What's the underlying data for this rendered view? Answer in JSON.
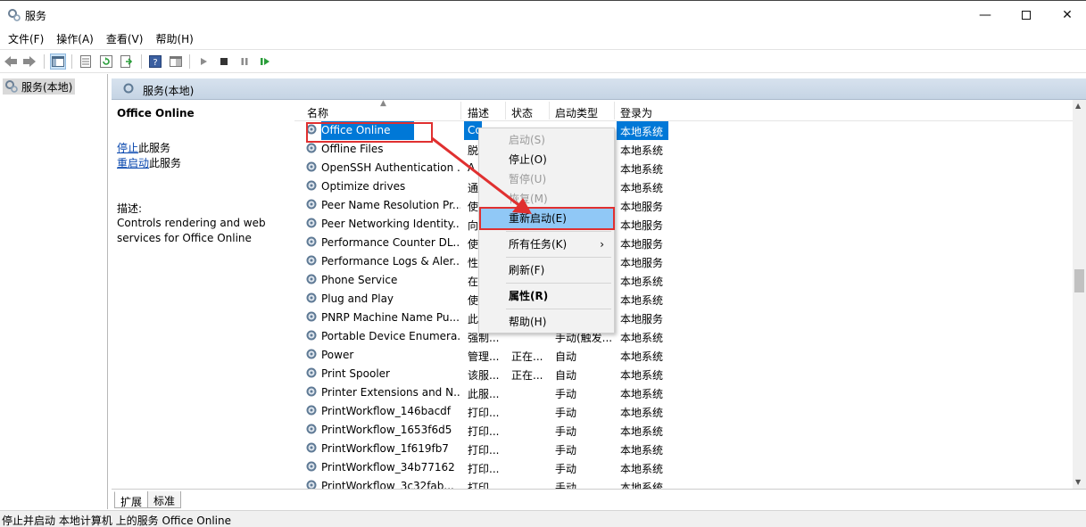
{
  "window": {
    "title": "服务"
  },
  "menu": [
    "文件(F)",
    "操作(A)",
    "查看(V)",
    "帮助(H)"
  ],
  "tree": {
    "root": "服务(本地)"
  },
  "pane": {
    "header": "服务(本地)"
  },
  "detail": {
    "service_name": "Office Online",
    "stop_link": "停止",
    "stop_suffix": "此服务",
    "restart_link": "重启动",
    "restart_suffix": "此服务",
    "desc_label": "描述:",
    "description": "Controls rendering and web services for Office Online"
  },
  "columns": {
    "name": "名称",
    "desc": "描述",
    "status": "状态",
    "startup": "启动类型",
    "logon": "登录为"
  },
  "rows": [
    {
      "name": "Office Online",
      "desc": "Co",
      "status": "",
      "startup": "",
      "logon": "本地系统"
    },
    {
      "name": "Offline Files",
      "desc": "脱",
      "status": "",
      "startup": "",
      "logon": "本地系统"
    },
    {
      "name": "OpenSSH Authentication ...",
      "desc": "A",
      "status": "",
      "startup": "",
      "logon": "本地系统"
    },
    {
      "name": "Optimize drives",
      "desc": "通",
      "status": "",
      "startup": "",
      "logon": "本地系统"
    },
    {
      "name": "Peer Name Resolution Pr...",
      "desc": "使",
      "status": "",
      "startup": "",
      "logon": "本地服务"
    },
    {
      "name": "Peer Networking Identity...",
      "desc": "向",
      "status": "",
      "startup": "",
      "logon": "本地服务"
    },
    {
      "name": "Performance Counter DL...",
      "desc": "使",
      "status": "",
      "startup": "",
      "logon": "本地服务"
    },
    {
      "name": "Performance Logs & Aler...",
      "desc": "性",
      "status": "",
      "startup": "",
      "logon": "本地服务"
    },
    {
      "name": "Phone Service",
      "desc": "在",
      "status": "",
      "startup": "",
      "logon": "本地系统"
    },
    {
      "name": "Plug and Play",
      "desc": "使",
      "status": "",
      "startup": "",
      "logon": "本地系统"
    },
    {
      "name": "PNRP Machine Name Pu...",
      "desc": "此",
      "status": "",
      "startup": "",
      "logon": "本地服务"
    },
    {
      "name": "Portable Device Enumera...",
      "desc": "强制...",
      "status": "",
      "startup": "手动(触发...",
      "logon": "本地系统"
    },
    {
      "name": "Power",
      "desc": "管理...",
      "status": "正在...",
      "startup": "自动",
      "logon": "本地系统"
    },
    {
      "name": "Print Spooler",
      "desc": "该服...",
      "status": "正在...",
      "startup": "自动",
      "logon": "本地系统"
    },
    {
      "name": "Printer Extensions and N...",
      "desc": "此服...",
      "status": "",
      "startup": "手动",
      "logon": "本地系统"
    },
    {
      "name": "PrintWorkflow_146bacdf",
      "desc": "打印...",
      "status": "",
      "startup": "手动",
      "logon": "本地系统"
    },
    {
      "name": "PrintWorkflow_1653f6d5",
      "desc": "打印...",
      "status": "",
      "startup": "手动",
      "logon": "本地系统"
    },
    {
      "name": "PrintWorkflow_1f619fb7",
      "desc": "打印...",
      "status": "",
      "startup": "手动",
      "logon": "本地系统"
    },
    {
      "name": "PrintWorkflow_34b77162",
      "desc": "打印...",
      "status": "",
      "startup": "手动",
      "logon": "本地系统"
    },
    {
      "name": "PrintWorkflow_3c32fab...",
      "desc": "打印...",
      "status": "",
      "startup": "手动",
      "logon": "本地系统"
    }
  ],
  "context_menu": {
    "start": "启动(S)",
    "stop": "停止(O)",
    "pause": "暂停(U)",
    "resume": "恢复(M)",
    "restart": "重新启动(E)",
    "all_tasks": "所有任务(K)",
    "refresh": "刷新(F)",
    "properties": "属性(R)",
    "help": "帮助(H)"
  },
  "tabs": [
    "扩展",
    "标准"
  ],
  "status_bar": "停止并启动 本地计算机 上的服务 Office Online",
  "colors": {
    "selection": "#0078d7",
    "highlight": "#90c8f6",
    "annotation": "#e03030",
    "header": "#c5d4e4"
  }
}
